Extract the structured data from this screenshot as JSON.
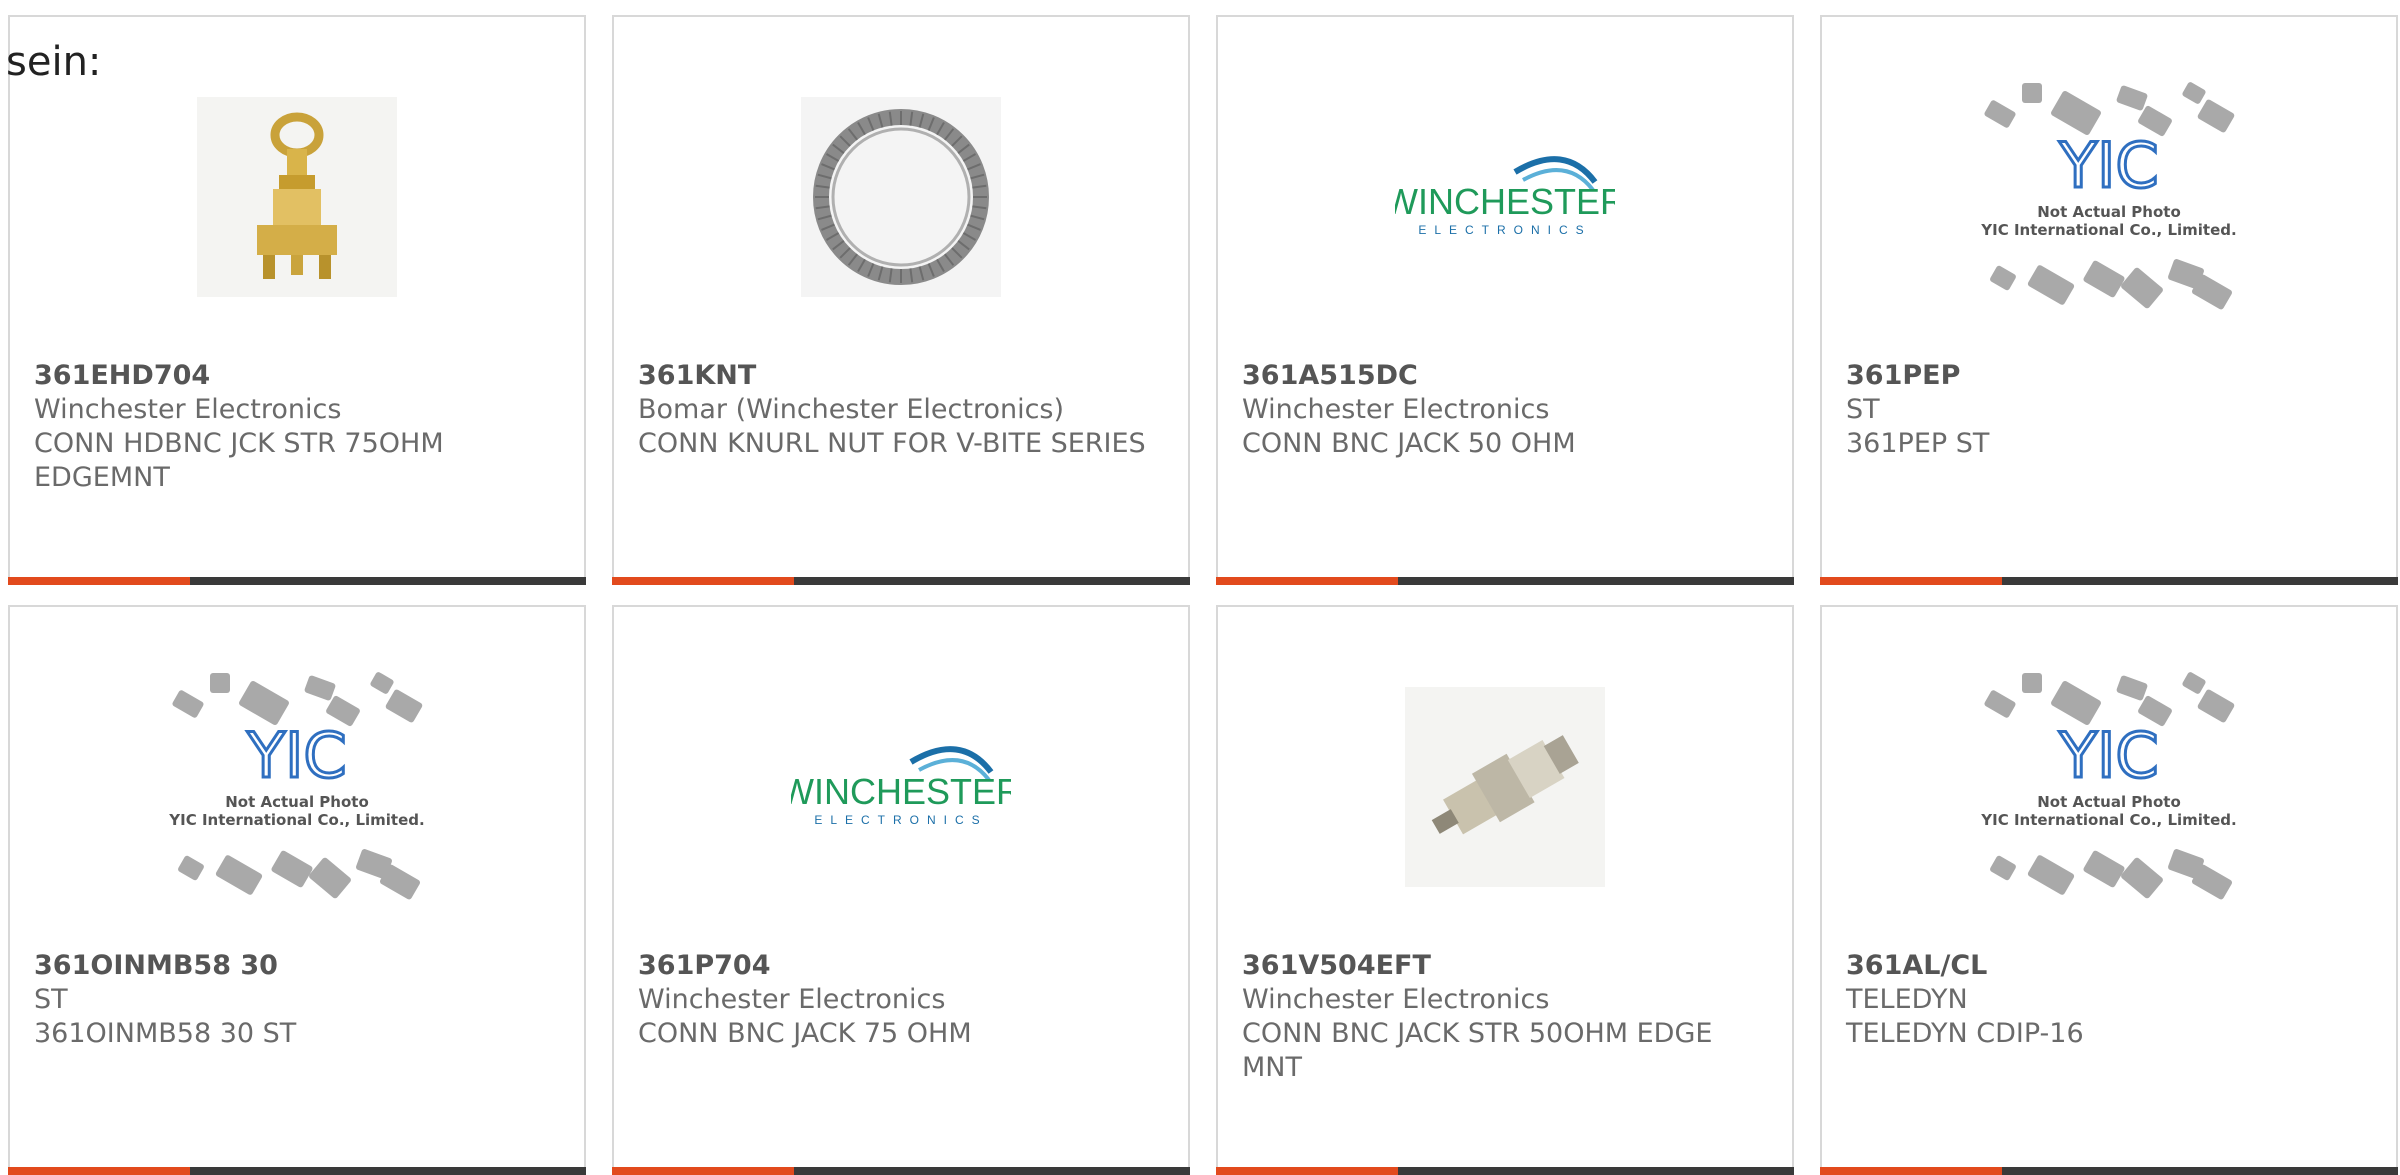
{
  "partial_header_text": "sein:",
  "accent_color": "#e24a1d",
  "bar_color": "#3a3a3a",
  "products": [
    {
      "part_number": "361EHD704",
      "manufacturer": "Winchester Electronics",
      "description": "CONN HDBNC JCK STR 75OHM EDGEMNT",
      "image": "gold-connector-photo"
    },
    {
      "part_number": "361KNT",
      "manufacturer": "Bomar (Winchester Electronics)",
      "description": "CONN KNURL NUT FOR V-BITE SERIES",
      "image": "knurled-nut-photo"
    },
    {
      "part_number": "361A515DC",
      "manufacturer": "Winchester Electronics",
      "description": "CONN BNC JACK 50 OHM",
      "image": "winchester-logo"
    },
    {
      "part_number": "361PEP",
      "manufacturer": "ST",
      "description": "361PEP ST",
      "image": "yic-placeholder"
    },
    {
      "part_number": "361OINMB58 30",
      "manufacturer": "ST",
      "description": "361OINMB58 30 ST",
      "image": "yic-placeholder"
    },
    {
      "part_number": "361P704",
      "manufacturer": "Winchester Electronics",
      "description": "CONN BNC JACK 75 OHM",
      "image": "winchester-logo"
    },
    {
      "part_number": "361V504EFT",
      "manufacturer": "Winchester Electronics",
      "description": "CONN BNC JACK STR 50OHM EDGE MNT",
      "image": "bnc-connector-photo"
    },
    {
      "part_number": "361AL/CL",
      "manufacturer": "TELEDYN",
      "description": "TELEDYN CDIP-16",
      "image": "yic-placeholder"
    }
  ],
  "winchester_logo": {
    "word": "WINCHESTER",
    "sub": "ELECTRONICS",
    "color_word": "#1f9a5a",
    "color_sub": "#1b6fa8"
  },
  "yic_placeholder": {
    "logo": "YIC",
    "line1": "Not Actual Photo",
    "line2": "YIC International Co., Limited."
  }
}
